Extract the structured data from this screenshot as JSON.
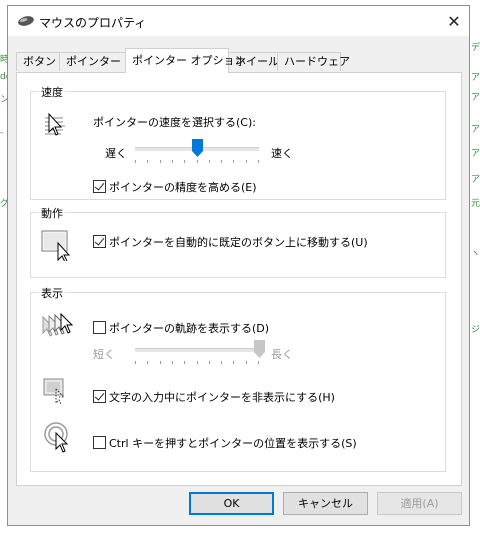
{
  "window": {
    "title": "マウスのプロパティ",
    "close_glyph": "✕"
  },
  "tabs": [
    {
      "label": "ボタン",
      "active": false
    },
    {
      "label": "ポインター",
      "active": false
    },
    {
      "label": "ポインター オプション",
      "active": true
    },
    {
      "label": "ホイール",
      "active": false
    },
    {
      "label": "ハードウェア",
      "active": false
    }
  ],
  "speed": {
    "group_title": "速度",
    "prompt": "ポインターの速度を選択する(C):",
    "slow": "遅く",
    "fast": "速く",
    "slider_level": 0.5,
    "precision_label": "ポインターの精度を高める(E)",
    "precision_checked": true
  },
  "motion": {
    "group_title": "動作",
    "snap_label": "ポインターを自動的に既定のボタン上に移動する(U)",
    "snap_checked": true
  },
  "visibility": {
    "group_title": "表示",
    "trails_label": "ポインターの軌跡を表示する(D)",
    "trails_checked": false,
    "short": "短く",
    "long": "長く",
    "trail_level": 1.0,
    "hide_label": "文字の入力中にポインターを非表示にする(H)",
    "hide_checked": true,
    "ctrl_label": "Ctrl キーを押すとポインターの位置を表示する(S)",
    "ctrl_checked": false
  },
  "footer": {
    "ok": "OK",
    "cancel": "キャンセル",
    "apply": "適用(A)"
  },
  "icons": {
    "title": "mouse-icon",
    "speed": "pointer-speed-icon",
    "snap": "snap-to-button-icon",
    "trails": "pointer-trails-icon",
    "hide": "hide-pointer-icon",
    "ctrl": "locate-pointer-icon"
  }
}
